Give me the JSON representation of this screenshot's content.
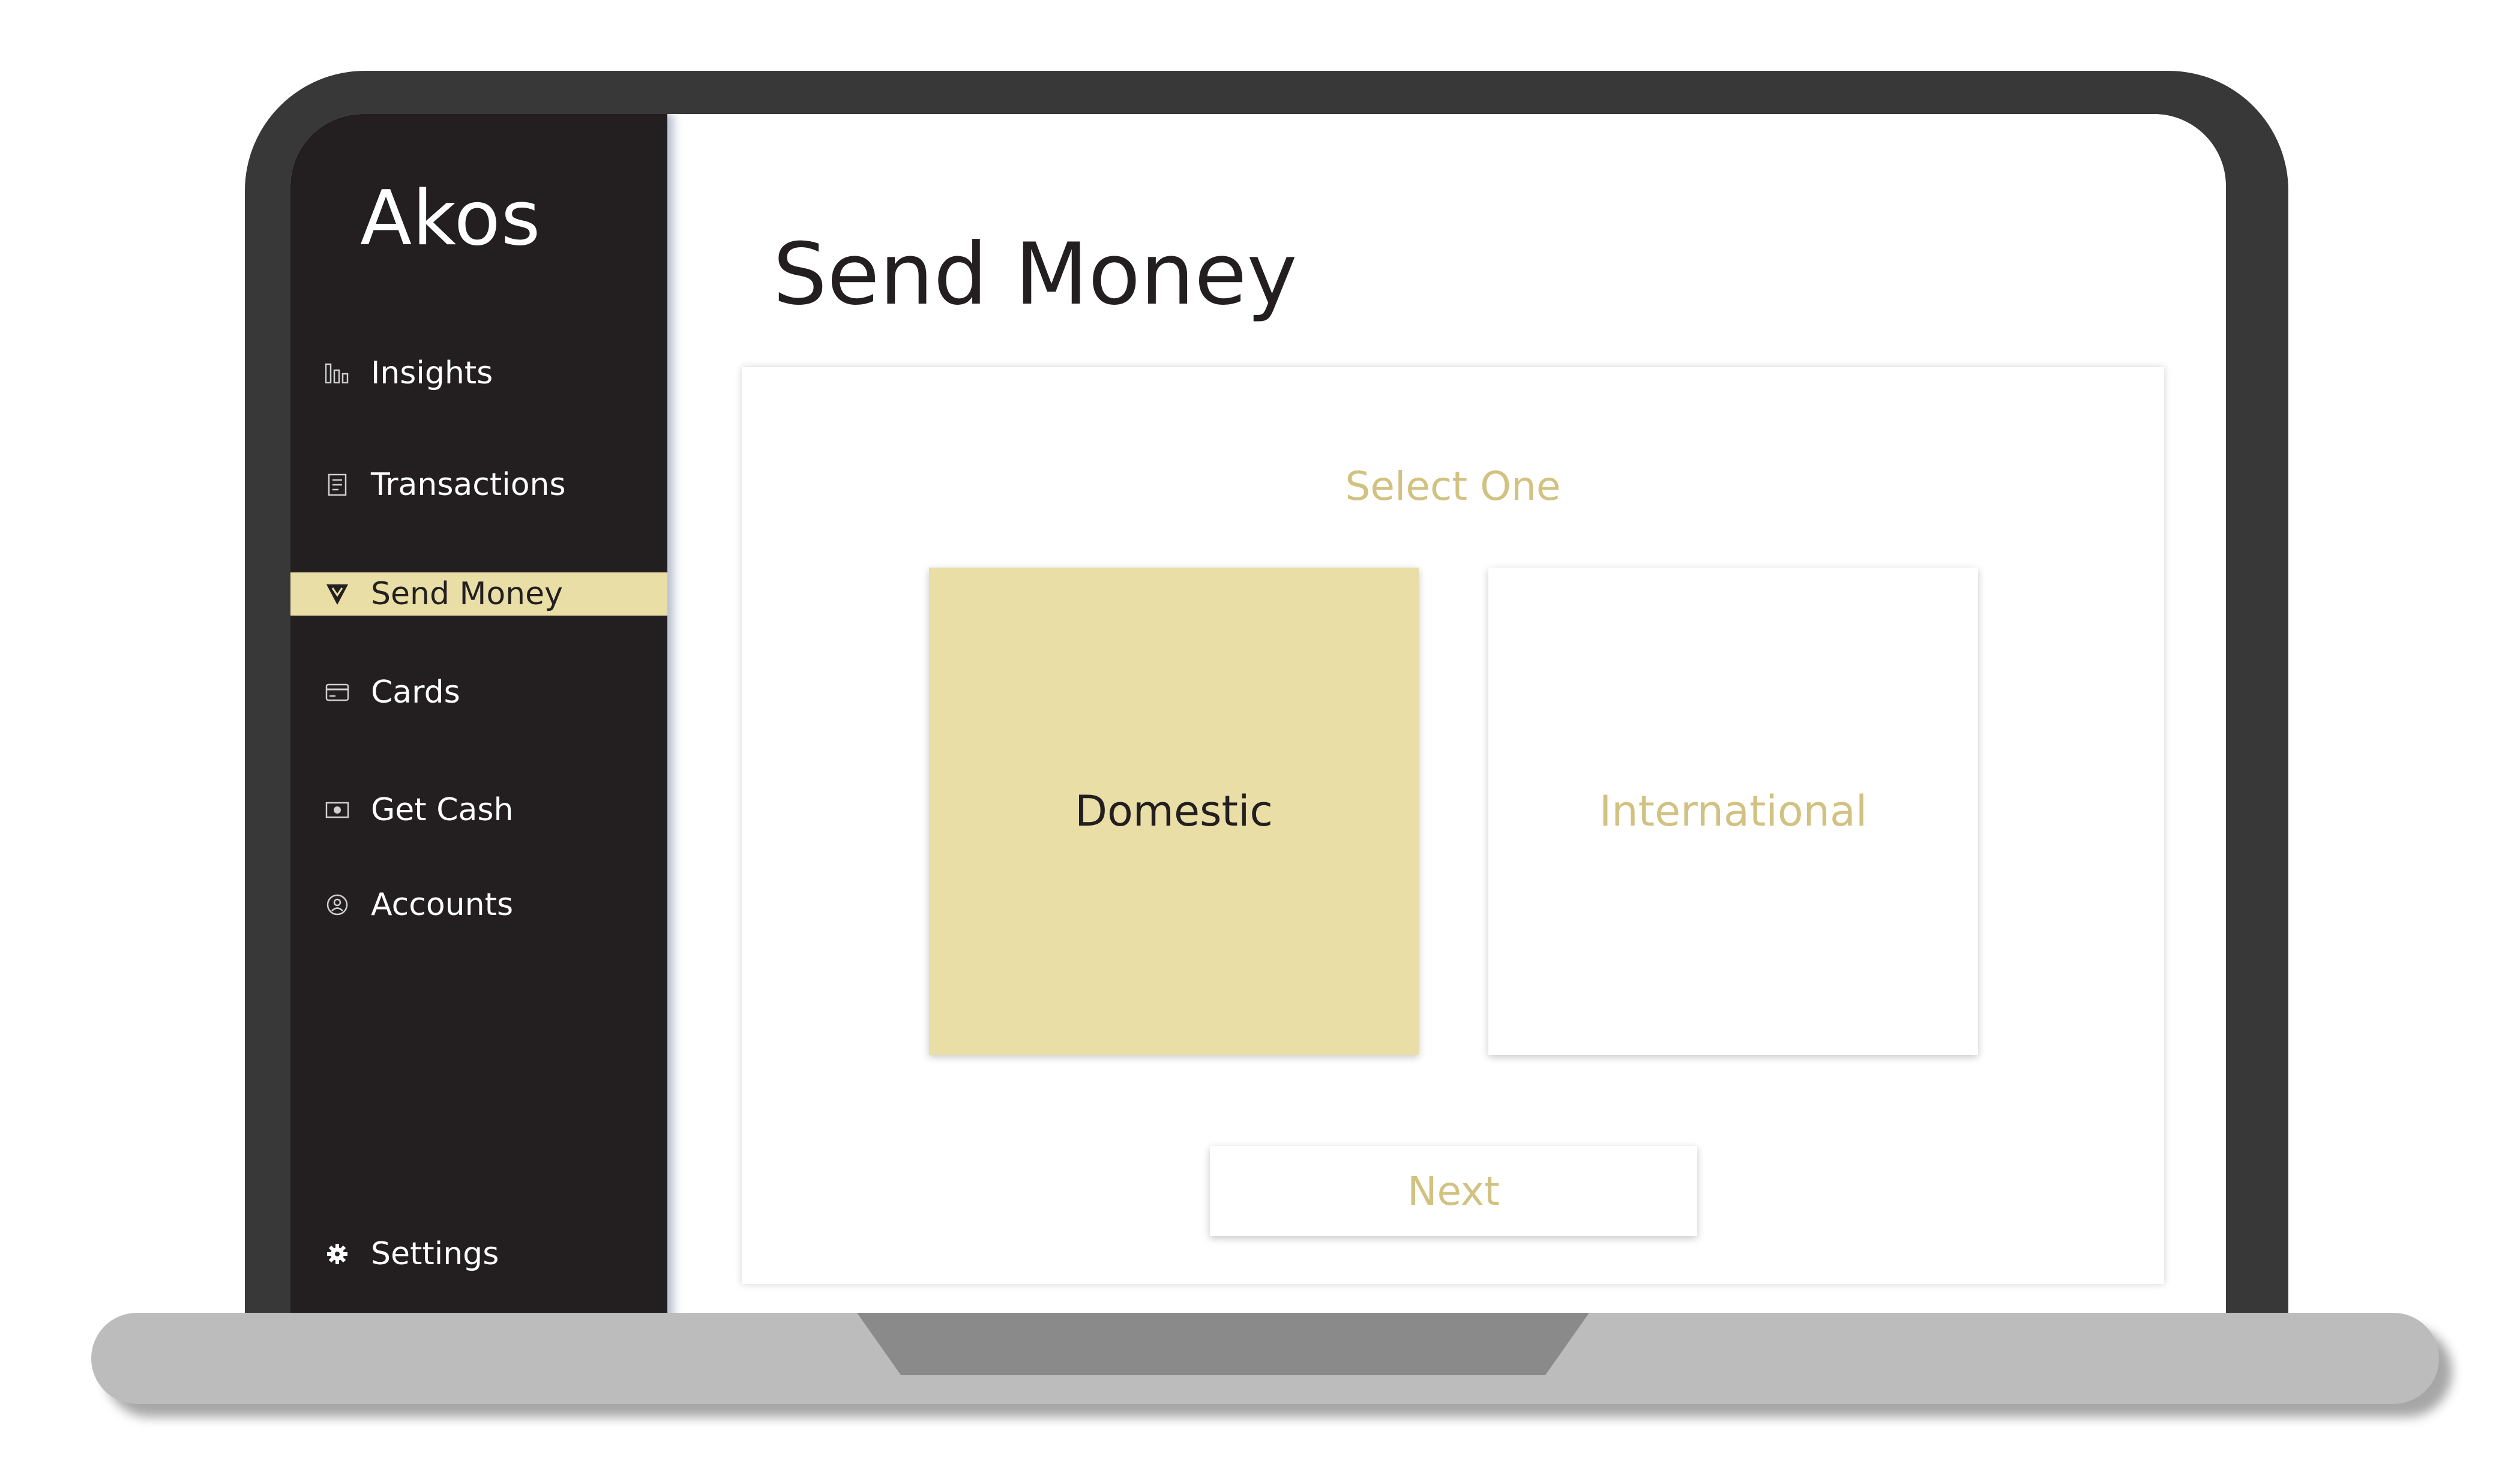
{
  "app": {
    "brand": "Akos"
  },
  "sidebar": {
    "items": [
      {
        "label": "Insights",
        "icon": "bar-chart-icon",
        "active": false
      },
      {
        "label": "Transactions",
        "icon": "receipt-icon",
        "active": false
      },
      {
        "label": "Send Money",
        "icon": "send-icon",
        "active": true
      },
      {
        "label": "Cards",
        "icon": "card-icon",
        "active": false
      },
      {
        "label": "Get Cash",
        "icon": "cash-icon",
        "active": false
      },
      {
        "label": "Accounts",
        "icon": "user-icon",
        "active": false
      }
    ],
    "settings": {
      "label": "Settings",
      "icon": "gear-icon"
    }
  },
  "main": {
    "title": "Send Money",
    "prompt": "Select One",
    "options": [
      {
        "label": "Domestic",
        "selected": true
      },
      {
        "label": "International",
        "selected": false
      }
    ],
    "next_label": "Next"
  },
  "colors": {
    "sidebar_bg": "#231f20",
    "accent": "#e9dea5",
    "accent_text": "#d2c282",
    "bezel": "#383838",
    "base": "#bcbcbc"
  }
}
